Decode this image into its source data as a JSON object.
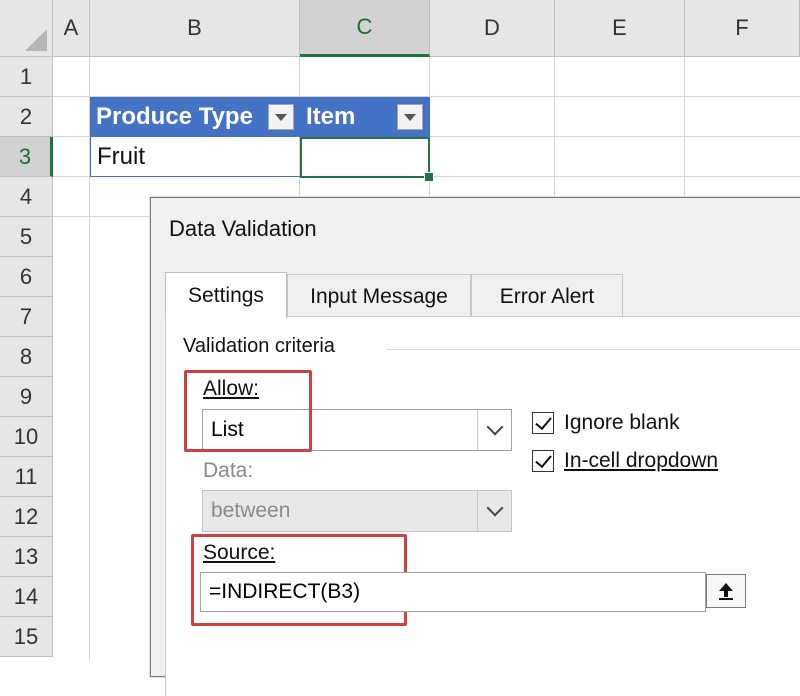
{
  "sheet": {
    "columns": [
      "A",
      "B",
      "C",
      "D",
      "E",
      "F"
    ],
    "rows": [
      "1",
      "2",
      "3",
      "4",
      "5",
      "6",
      "7",
      "8",
      "9",
      "10",
      "11",
      "12",
      "13",
      "14",
      "15"
    ],
    "selected_column": "C",
    "selected_row": "3",
    "table_headers": [
      "Produce Type",
      "Item"
    ],
    "cells": {
      "B3": "Fruit",
      "C3": ""
    }
  },
  "dialog": {
    "title": "Data Validation",
    "tabs": [
      "Settings",
      "Input Message",
      "Error Alert"
    ],
    "active_tab": "Settings",
    "validation_criteria_label": "Validation criteria",
    "allow_label": "Allow:",
    "allow_value": "List",
    "data_label": "Data:",
    "data_value": "between",
    "ignore_blank_label": "Ignore blank",
    "ignore_blank_checked": true,
    "incell_dropdown_label": "In-cell dropdown",
    "incell_dropdown_checked": true,
    "source_label": "Source:",
    "source_value": "=INDIRECT(B3)",
    "highlight_color": "#d04040"
  },
  "colors": {
    "table_header_bg": "#4472c4",
    "excel_green": "#217346"
  }
}
